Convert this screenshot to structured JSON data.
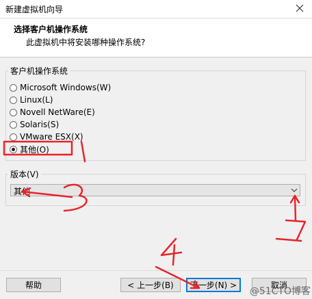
{
  "window": {
    "title": "新建虚拟机向导"
  },
  "header": {
    "title": "选择客户机操作系统",
    "subtitle": "此虚拟机中将安装哪种操作系统?"
  },
  "os_group": {
    "title": "客户机操作系统",
    "options": [
      {
        "label": "Microsoft Windows(W)",
        "checked": false
      },
      {
        "label": "Linux(L)",
        "checked": false
      },
      {
        "label": "Novell NetWare(E)",
        "checked": false
      },
      {
        "label": "Solaris(S)",
        "checked": false
      },
      {
        "label": "VMware ESX(X)",
        "checked": false
      },
      {
        "label": "其他(O)",
        "checked": true
      }
    ]
  },
  "version_group": {
    "title": "版本(V)",
    "selected": "其他"
  },
  "buttons": {
    "help": "帮助",
    "back": "< 上一步(B)",
    "next": "下一步(N) >",
    "cancel": "取消"
  },
  "annotations": {
    "n1": "1",
    "n2": "2",
    "n3": "3",
    "n4": "4",
    "color": "#e8242a"
  },
  "watermark": "@51CTO博客"
}
